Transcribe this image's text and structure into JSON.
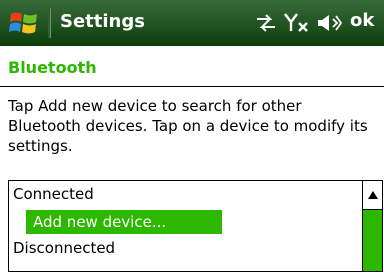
{
  "title_bar": {
    "title": "Settings",
    "ok_label": "ok",
    "icons": [
      "windows-start-icon",
      "connectivity-icon",
      "signal-off-icon",
      "speaker-icon"
    ]
  },
  "page": {
    "title": "Bluetooth",
    "instructions": "Tap Add new device to search for other Bluetooth devices. Tap on a device to modify its settings."
  },
  "device_list": {
    "groups": [
      {
        "label": "Connected",
        "items": [
          "Add new device..."
        ]
      },
      {
        "label": "Disconnected",
        "items": []
      }
    ]
  },
  "colors": {
    "title_bar": "#0c3e0c",
    "accent": "#2db800"
  }
}
